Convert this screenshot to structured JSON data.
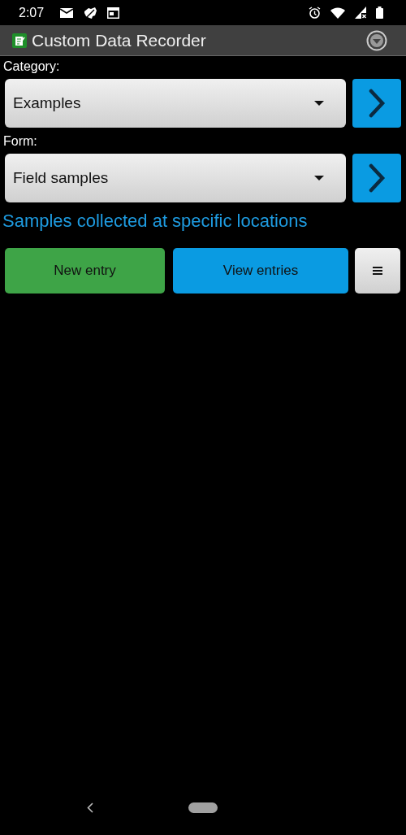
{
  "status_bar": {
    "time": "2:07"
  },
  "app_bar": {
    "title": "Custom Data Recorder"
  },
  "selectors": [
    {
      "label": "Category:",
      "value": "Examples"
    },
    {
      "label": "Form:",
      "value": "Field samples"
    }
  ],
  "description": "Samples collected at specific locations",
  "actions": [
    {
      "label": "New entry",
      "kind": "new"
    },
    {
      "label": "View entries",
      "kind": "view"
    }
  ]
}
